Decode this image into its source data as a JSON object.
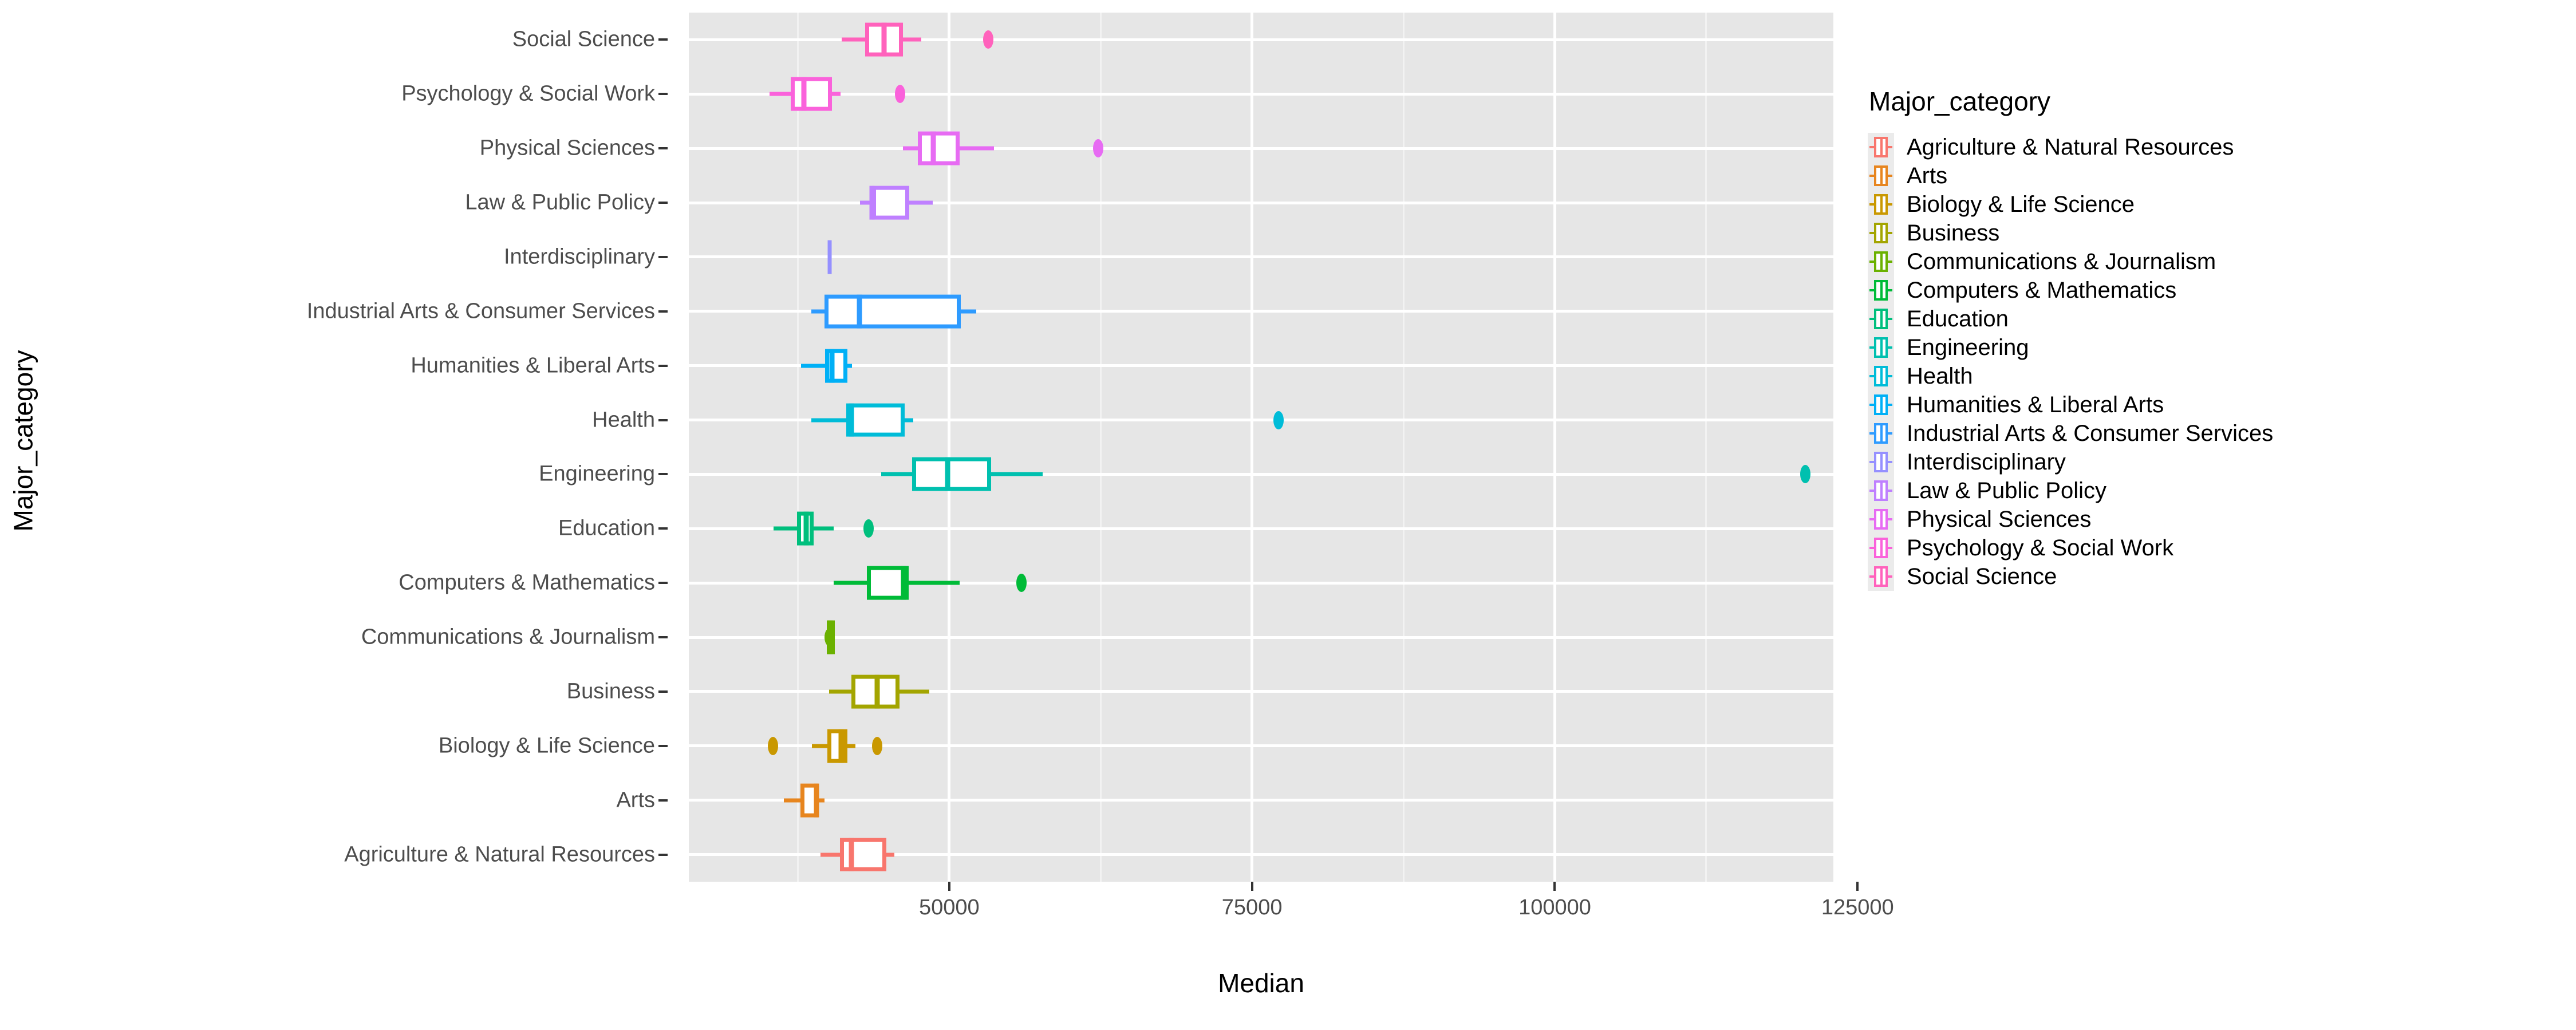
{
  "axes": {
    "ylabel": "Major_category",
    "xlabel": "Median",
    "x_ticks": [
      {
        "value": 50000,
        "label": "50000"
      },
      {
        "value": 75000,
        "label": "75000"
      },
      {
        "value": 100000,
        "label": "100000"
      },
      {
        "value": 125000,
        "label": "125000"
      }
    ],
    "x_minor_ticks": [
      37500,
      62500,
      87500,
      112500
    ],
    "xlim": [
      28500,
      123000
    ]
  },
  "legend": {
    "title": "Major_category",
    "items": [
      {
        "label": "Agriculture & Natural Resources",
        "color": "#F8766D"
      },
      {
        "label": "Arts",
        "color": "#E7851E"
      },
      {
        "label": "Biology & Life Science",
        "color": "#C99800"
      },
      {
        "label": "Business",
        "color": "#A3A500"
      },
      {
        "label": "Communications & Journalism",
        "color": "#6BB100"
      },
      {
        "label": "Computers & Mathematics",
        "color": "#00BB38"
      },
      {
        "label": "Education",
        "color": "#00BF7D"
      },
      {
        "label": "Engineering",
        "color": "#00C0AF"
      },
      {
        "label": "Health",
        "color": "#00BCD8"
      },
      {
        "label": "Humanities & Liberal Arts",
        "color": "#00B0F6"
      },
      {
        "label": "Industrial Arts & Consumer Services",
        "color": "#2E9BFF"
      },
      {
        "label": "Interdisciplinary",
        "color": "#9590FF"
      },
      {
        "label": "Law & Public Policy",
        "color": "#BF80FF"
      },
      {
        "label": "Physical Sciences",
        "color": "#E76BF3"
      },
      {
        "label": "Psychology & Social Work",
        "color": "#FA62DB"
      },
      {
        "label": "Social Science",
        "color": "#FF62BC"
      }
    ]
  },
  "chart_data": {
    "type": "box",
    "orientation": "horizontal",
    "title": "",
    "xlabel": "Median",
    "ylabel": "Major_category",
    "xlim": [
      28500,
      123000
    ],
    "grid": true,
    "legend_position": "right",
    "categories": [
      "Social Science",
      "Psychology & Social Work",
      "Physical Sciences",
      "Law & Public Policy",
      "Interdisciplinary",
      "Industrial Arts & Consumer Services",
      "Humanities & Liberal Arts",
      "Health",
      "Engineering",
      "Education",
      "Computers & Mathematics",
      "Communications & Journalism",
      "Business",
      "Biology & Life Science",
      "Arts",
      "Agriculture & Natural Resources"
    ],
    "boxes": [
      {
        "category": "Social Science",
        "color": "#FF62BC",
        "whisker_low": 41100,
        "q1": 43060,
        "median": 44635,
        "q3": 46165,
        "whisker_high": 47695,
        "outliers": [
          53205
        ]
      },
      {
        "category": "Psychology & Social Work",
        "color": "#FA62DB",
        "whisker_low": 35180,
        "q1": 36900,
        "median": 38000,
        "q3": 40340,
        "whisker_high": 41050,
        "outliers": [
          45960
        ]
      },
      {
        "category": "Physical Sciences",
        "color": "#E76BF3",
        "whisker_low": 46160,
        "q1": 47400,
        "median": 48690,
        "q3": 50840,
        "whisker_high": 53710,
        "outliers": [
          62320
        ]
      },
      {
        "category": "Law & Public Policy",
        "color": "#BF80FF",
        "whisker_low": 42640,
        "q1": 43640,
        "median": 43640,
        "q3": 46700,
        "whisker_high": 48620,
        "outliers": []
      },
      {
        "category": "Interdisciplinary",
        "color": "#9590FF",
        "whisker_low": 40110,
        "q1": 40110,
        "median": 40110,
        "q3": 40110,
        "whisker_high": 40110,
        "outliers": []
      },
      {
        "category": "Industrial Arts & Consumer Services",
        "color": "#2E9BFF",
        "whisker_low": 38620,
        "q1": 39720,
        "median": 42580,
        "q3": 50940,
        "whisker_high": 52230,
        "outliers": []
      },
      {
        "category": "Humanities & Liberal Arts",
        "color": "#00B0F6",
        "whisker_low": 37760,
        "q1": 39770,
        "median": 40340,
        "q3": 41580,
        "whisker_high": 41960,
        "outliers": []
      },
      {
        "category": "Health",
        "color": "#00BCD8",
        "whisker_low": 38620,
        "q1": 41480,
        "median": 41910,
        "q3": 46310,
        "whisker_high": 47020,
        "outliers": [
          77170
        ]
      },
      {
        "category": "Engineering",
        "color": "#00C0AF",
        "whisker_low": 44400,
        "q1": 46930,
        "median": 49850,
        "q3": 53480,
        "whisker_high": 57730,
        "outliers": [
          120690
        ]
      },
      {
        "category": "Education",
        "color": "#00BF7D",
        "whisker_low": 35510,
        "q1": 37420,
        "median": 38190,
        "q3": 38810,
        "whisker_high": 40480,
        "outliers": [
          43350
        ]
      },
      {
        "category": "Computers & Mathematics",
        "color": "#00BB38",
        "whisker_low": 40480,
        "q1": 43210,
        "median": 46210,
        "q3": 46640,
        "whisker_high": 50840,
        "outliers": [
          55950
        ]
      },
      {
        "category": "Communications & Journalism",
        "color": "#6BB100",
        "whisker_low": 39910,
        "q1": 39910,
        "median": 40200,
        "q3": 40480,
        "whisker_high": 40480,
        "outliers": [
          40110
        ]
      },
      {
        "category": "Business",
        "color": "#A3A500",
        "whisker_low": 40100,
        "q1": 41910,
        "median": 44060,
        "q3": 45920,
        "whisker_high": 48360,
        "outliers": []
      },
      {
        "category": "Biology & Life Science",
        "color": "#C99800",
        "whisker_low": 38670,
        "q1": 39960,
        "median": 41060,
        "q3": 41580,
        "whisker_high": 42250,
        "outliers": [
          35430,
          44060
        ]
      },
      {
        "category": "Arts",
        "color": "#E7851E",
        "whisker_low": 36330,
        "q1": 37720,
        "median": 39050,
        "q3": 39200,
        "whisker_high": 39720,
        "outliers": []
      },
      {
        "category": "Agriculture & Natural Resources",
        "color": "#F8766D",
        "whisker_low": 39390,
        "q1": 40960,
        "median": 41910,
        "q3": 44830,
        "whisker_high": 45490,
        "outliers": []
      }
    ]
  }
}
